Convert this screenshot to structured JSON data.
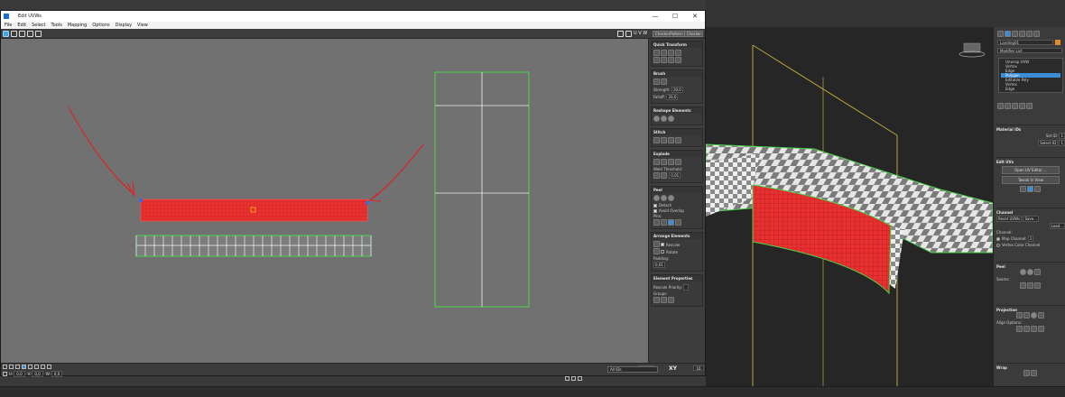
{
  "window": {
    "title": "Edit UVWs",
    "controls": [
      "—",
      "☐",
      "✕"
    ]
  },
  "menu": [
    "File",
    "Edit",
    "Select",
    "Tools",
    "Mapping",
    "Options",
    "Display",
    "View"
  ],
  "toolbar": {
    "uv_label": "U V W",
    "checker": "CheckerPattern ( Checker )"
  },
  "rollouts": {
    "quick_transform": "Quick Transform",
    "brush": "Brush",
    "strength_label": "Strength:",
    "strength_value": "20,0",
    "falloff_label": "Falloff:",
    "falloff_value": "20,0",
    "reshape": "Reshape Elements",
    "stitch": "Stitch",
    "explode": "Explode",
    "weld_label": "Weld",
    "threshold_label": "Threshold:",
    "threshold_value": "0,01",
    "peel": "Peel",
    "detach": "Detach",
    "avoid_overlap": "Avoid Overlap",
    "pins": "Pins:",
    "arrange": "Arrange Elements",
    "rescale": "Rescale",
    "rotate": "Rotate",
    "padding_label": "Padding:",
    "padding_value": "0,01",
    "element_props": "Element Properties",
    "rescale_priority": "Rescale Priority:",
    "groups": "Groups:"
  },
  "status": {
    "u_label": "U:",
    "u_value": "0,0",
    "v_label": "V:",
    "v_value": "0,0",
    "w_label": "W:",
    "w_value": "0,0",
    "xy": "XY",
    "zoom": "0,0",
    "grid": "16",
    "filter": "All IDs"
  },
  "command_panel": {
    "object_name": "Landing01",
    "modifier_list": "Modifier List",
    "stack": [
      {
        "label": "Unwrap UVW",
        "selected": false
      },
      {
        "label": "Vertex",
        "selected": false
      },
      {
        "label": "Edge",
        "selected": false
      },
      {
        "label": "Polygon",
        "selected": true
      },
      {
        "label": "Editable Poly",
        "selected": false
      },
      {
        "label": "Vertex",
        "selected": false
      },
      {
        "label": "Edge",
        "selected": false
      }
    ],
    "material_ids": "Material IDs",
    "set_id": "Set ID:",
    "set_id_value": "1",
    "select_id": "Select ID",
    "select_id_value": "1",
    "edit_uvs": "Edit UVs",
    "open_uv_editor": "Open UV Editor ...",
    "tweak_in_view": "Tweak In View",
    "channel": "Channel",
    "reset_uvws": "Reset UVWs",
    "save": "Save...",
    "load": "Load...",
    "channel_label": "Channel:",
    "map_channel": "Map Channel:",
    "map_channel_value": "1",
    "vertex_color_channel": "Vertex Color Channel",
    "peel": "Peel",
    "seams": "Seams:",
    "projection": "Projection",
    "align_options": "Align Options:",
    "wrap": "Wrap"
  },
  "colors": {
    "uv_background": "#717171",
    "selected_uv": "#e83030",
    "annotation": "#e02020",
    "uv_edge": "#f2f2f2",
    "uv_border": "#49d449",
    "accent": "#3b8ed6"
  }
}
